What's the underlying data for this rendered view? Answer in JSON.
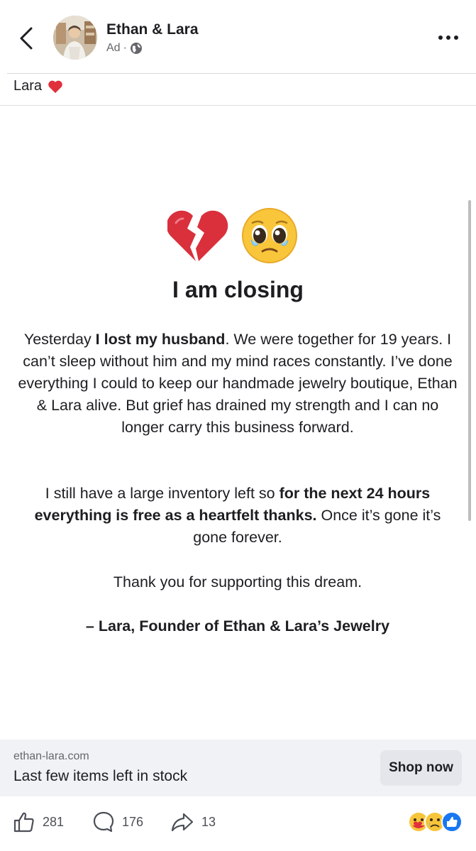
{
  "header": {
    "page_name": "Ethan & Lara",
    "ad_label": "Ad",
    "separator": "·"
  },
  "post": {
    "caption": "Lara",
    "headline": "I am closing",
    "p1": {
      "t1": "Yesterday ",
      "b1": "I lost my husband",
      "t2": ". We were together for 19 years. I can’t sleep without him and my mind races constantly. I’ve done everything I could to keep our handmade jewelry boutique, Ethan & Lara alive. But grief has drained my strength and I can no longer carry this business forward."
    },
    "p2": {
      "t1": "I still have a large inventory left so ",
      "b1": "for the next 24 hours everything is free as a heartfelt thanks.",
      "t2": " Once it’s gone it’s gone forever."
    },
    "p3": "Thank you for supporting this dream.",
    "signature": "– Lara, Founder of Ethan & Lara’s Jewelry"
  },
  "link": {
    "domain": "ethan-lara.com",
    "title": "Last few items left in stock",
    "cta": "Shop now"
  },
  "actions": {
    "likes": "281",
    "comments": "176",
    "shares": "13"
  },
  "icons": {
    "back": "chevron-left-icon",
    "more": "more-dots-icon",
    "globe": "globe-icon",
    "like": "thumbs-up-icon",
    "comment": "comment-bubble-icon",
    "share": "share-arrow-icon"
  },
  "colors": {
    "heart_red": "#e0303c",
    "link_bar_bg": "#f0f2f5",
    "button_bg": "#e4e6eb",
    "like_blue": "#1877f2"
  }
}
